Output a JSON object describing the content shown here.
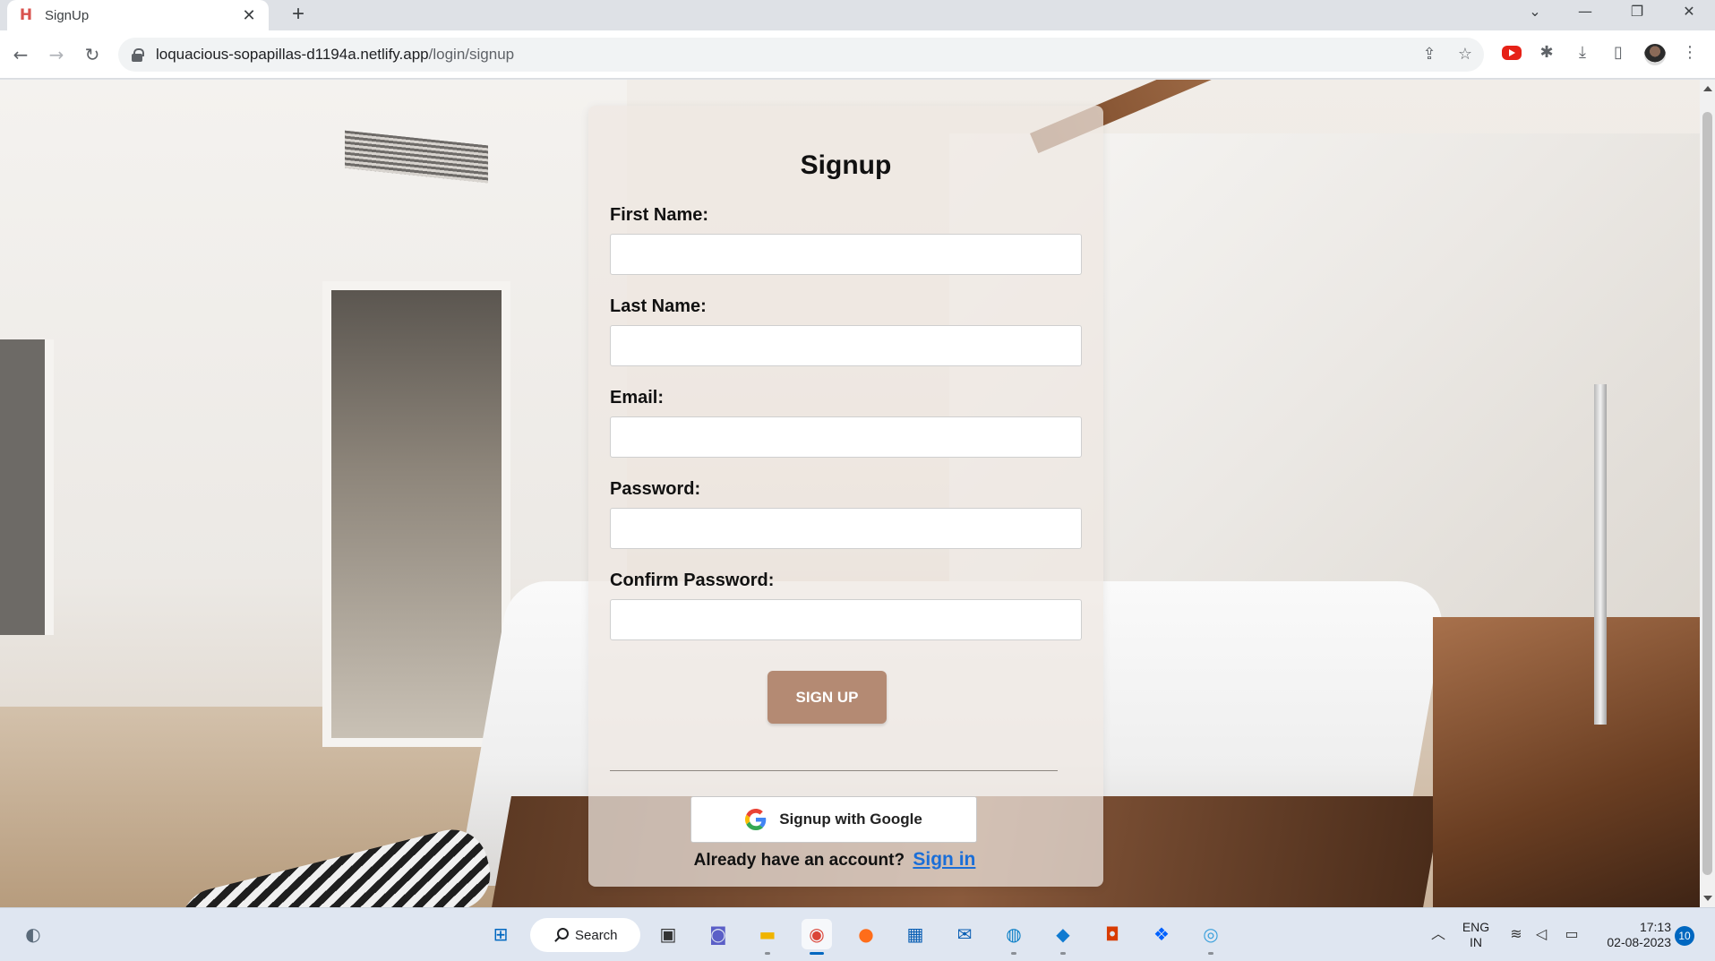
{
  "browser": {
    "tab_title": "SignUp",
    "tab_favicon": "H",
    "url_host": "loquacious-sopapillas-d1194a.netlify.app",
    "url_path": "/login/signup"
  },
  "form": {
    "title": "Signup",
    "fields": [
      {
        "label": "First Name:",
        "value": ""
      },
      {
        "label": "Last Name:",
        "value": ""
      },
      {
        "label": "Email:",
        "value": ""
      },
      {
        "label": "Password:",
        "value": ""
      },
      {
        "label": "Confirm Password:",
        "value": ""
      }
    ],
    "submit_label": "SIGN UP",
    "google_label": "Signup with Google",
    "already_text": "Already have an account?",
    "signin_label": "Sign in"
  },
  "taskbar": {
    "search_label": "Search",
    "lang_line1": "ENG",
    "lang_line2": "IN",
    "time": "17:13",
    "date": "02-08-2023",
    "notifications": "10"
  },
  "colors": {
    "signup_button": "#b48a73",
    "link": "#1a6ed8"
  }
}
